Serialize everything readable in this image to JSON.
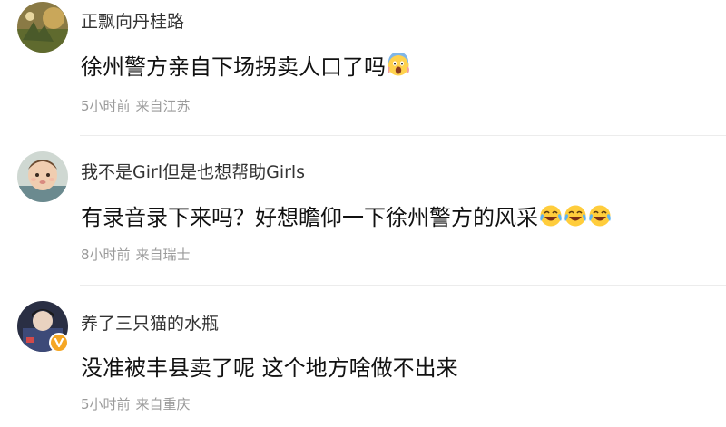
{
  "comments": [
    {
      "username": "正飘向丹桂路",
      "content": "徐州警方亲自下场拐卖人口了吗",
      "emojis": [
        "scream-emoji"
      ],
      "time": "5小时前",
      "location": "来自江苏",
      "verified": false
    },
    {
      "username": "我不是Girl但是也想帮助Girls",
      "content": "有录音录下来吗？好想瞻仰一下徐州警方的风采",
      "emojis": [
        "laugh-cry-emoji",
        "laugh-cry-emoji",
        "laugh-cry-emoji"
      ],
      "time": "8小时前",
      "location": "来自瑞士",
      "verified": false
    },
    {
      "username": "养了三只猫的水瓶",
      "content": "没准被丰县卖了呢 这个地方啥做不出来",
      "emojis": [],
      "time": "5小时前",
      "location": "来自重庆",
      "verified": true
    }
  ],
  "colors": {
    "username": "#333333",
    "content": "#111111",
    "meta": "#9a9a9a",
    "divider": "#ececec",
    "verified_badge": "#f5a623"
  }
}
